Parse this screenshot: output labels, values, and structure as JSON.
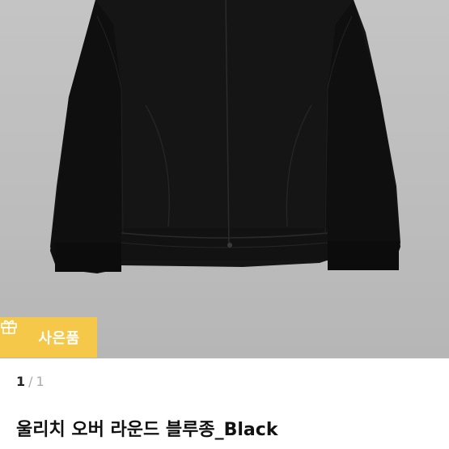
{
  "product": {
    "image_alt_icon": "jacket-image",
    "title": "울리치 오버 라운드 블루종_Black"
  },
  "badge": {
    "icon": "gift-icon",
    "label": "사은품",
    "color": "#f5c84a"
  },
  "pager": {
    "current": "1",
    "separator": "/",
    "total": "1"
  }
}
